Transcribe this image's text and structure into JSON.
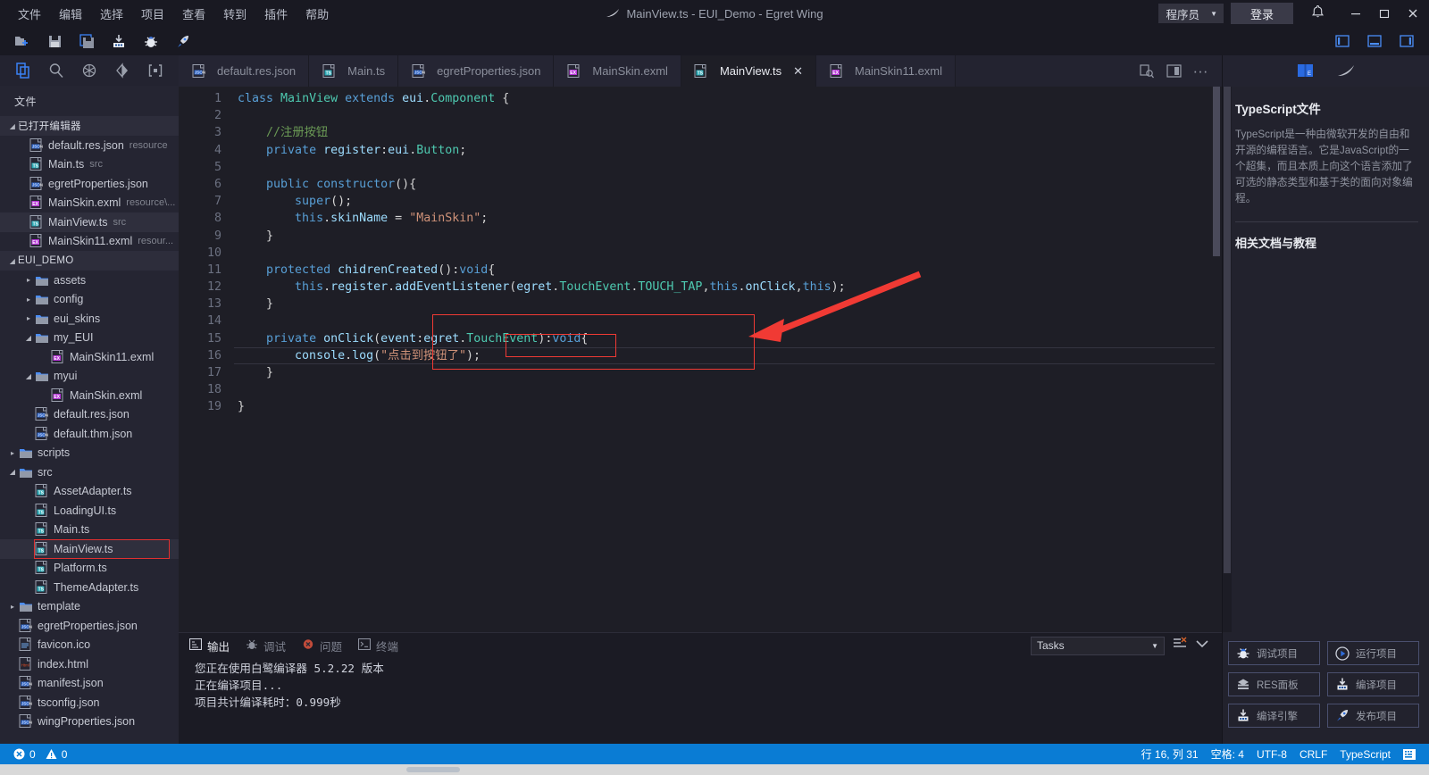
{
  "titlebar": {
    "menus": [
      "文件",
      "编辑",
      "选择",
      "项目",
      "查看",
      "转到",
      "插件",
      "帮助"
    ],
    "title": "MainView.ts - EUI_Demo - Egret Wing",
    "user_role": "程序员",
    "login_label": "登录",
    "icons": [
      "bell-icon",
      "minimize-icon",
      "maximize-icon",
      "close-icon"
    ]
  },
  "toolbar": {
    "icons": [
      "new-file-icon",
      "save-icon",
      "save-all-icon",
      "compile-icon",
      "debug-icon",
      "publish-icon"
    ],
    "layout_icons": [
      "toggle-sidebar-icon",
      "toggle-panel-icon",
      "toggle-right-sidebar-icon"
    ]
  },
  "activitybar": {
    "icons": [
      "explorer-icon",
      "search-icon",
      "extensions-icon",
      "source-control-icon",
      "debug-console-icon"
    ]
  },
  "explorer": {
    "header": "文件",
    "open_editors_label": "已打开编辑器",
    "open_editors": [
      {
        "name": "default.res.json",
        "sub": "resource",
        "icon": "json-file-icon"
      },
      {
        "name": "Main.ts",
        "sub": "src",
        "icon": "ts-file-icon"
      },
      {
        "name": "egretProperties.json",
        "sub": "",
        "icon": "json-file-icon"
      },
      {
        "name": "MainSkin.exml",
        "sub": "resource\\...",
        "icon": "exml-file-icon"
      },
      {
        "name": "MainView.ts",
        "sub": "src",
        "icon": "ts-file-icon",
        "selected": true
      },
      {
        "name": "MainSkin11.exml",
        "sub": "resour...",
        "icon": "exml-file-icon"
      }
    ],
    "project_label": "EUI_DEMO",
    "project_tree": [
      {
        "name": "assets",
        "type": "folder",
        "depth": 1,
        "expanded": false
      },
      {
        "name": "config",
        "type": "folder",
        "depth": 1,
        "expanded": false
      },
      {
        "name": "eui_skins",
        "type": "folder",
        "depth": 1,
        "expanded": false
      },
      {
        "name": "my_EUI",
        "type": "folder",
        "depth": 1,
        "expanded": true
      },
      {
        "name": "MainSkin11.exml",
        "type": "exml",
        "depth": 2
      },
      {
        "name": "myui",
        "type": "folder",
        "depth": 1,
        "expanded": true
      },
      {
        "name": "MainSkin.exml",
        "type": "exml",
        "depth": 2
      },
      {
        "name": "default.res.json",
        "type": "json",
        "depth": 1
      },
      {
        "name": "default.thm.json",
        "type": "json",
        "depth": 1
      },
      {
        "name": "scripts",
        "type": "folder",
        "depth": 0,
        "expanded": false
      },
      {
        "name": "src",
        "type": "folder",
        "depth": 0,
        "expanded": true
      },
      {
        "name": "AssetAdapter.ts",
        "type": "ts",
        "depth": 1
      },
      {
        "name": "LoadingUI.ts",
        "type": "ts",
        "depth": 1
      },
      {
        "name": "Main.ts",
        "type": "ts",
        "depth": 1
      },
      {
        "name": "MainView.ts",
        "type": "ts",
        "depth": 1,
        "highlighted": true,
        "selected": true
      },
      {
        "name": "Platform.ts",
        "type": "ts",
        "depth": 1
      },
      {
        "name": "ThemeAdapter.ts",
        "type": "ts",
        "depth": 1
      },
      {
        "name": "template",
        "type": "folder",
        "depth": 0,
        "expanded": false
      },
      {
        "name": "egretProperties.json",
        "type": "json",
        "depth": 0
      },
      {
        "name": "favicon.ico",
        "type": "ico",
        "depth": 0
      },
      {
        "name": "index.html",
        "type": "html",
        "depth": 0
      },
      {
        "name": "manifest.json",
        "type": "json",
        "depth": 0
      },
      {
        "name": "tsconfig.json",
        "type": "json",
        "depth": 0
      },
      {
        "name": "wingProperties.json",
        "type": "json",
        "depth": 0
      }
    ]
  },
  "editor": {
    "tabs": [
      {
        "label": "default.res.json",
        "icon": "json-file-icon",
        "active": false
      },
      {
        "label": "Main.ts",
        "icon": "ts-file-icon",
        "active": false
      },
      {
        "label": "egretProperties.json",
        "icon": "json-file-icon",
        "active": false
      },
      {
        "label": "MainSkin.exml",
        "icon": "exml-file-icon",
        "active": false
      },
      {
        "label": "MainView.ts",
        "icon": "ts-file-icon",
        "active": true
      },
      {
        "label": "MainSkin11.exml",
        "icon": "exml-file-icon",
        "active": false
      }
    ],
    "tab_actions": [
      "open-changes-icon",
      "split-editor-icon",
      "more-actions-icon"
    ],
    "lines": [
      {
        "n": "1",
        "text": "class MainView extends eui.Component {"
      },
      {
        "n": "2",
        "text": ""
      },
      {
        "n": "3",
        "text": "    //注册按钮"
      },
      {
        "n": "4",
        "text": "    private register:eui.Button;"
      },
      {
        "n": "5",
        "text": ""
      },
      {
        "n": "6",
        "text": "    public constructor(){"
      },
      {
        "n": "7",
        "text": "        super();"
      },
      {
        "n": "8",
        "text": "        this.skinName = \"MainSkin\";"
      },
      {
        "n": "9",
        "text": "    }"
      },
      {
        "n": "10",
        "text": ""
      },
      {
        "n": "11",
        "text": "    protected chidrenCreated():void{"
      },
      {
        "n": "12",
        "text": "        this.register.addEventListener(egret.TouchEvent.TOUCH_TAP,this.onClick,this);"
      },
      {
        "n": "13",
        "text": "    }"
      },
      {
        "n": "14",
        "text": ""
      },
      {
        "n": "15",
        "text": "    private onClick(event:egret.TouchEvent):void{"
      },
      {
        "n": "16",
        "text": "        console.log(\"点击到按钮了\");"
      },
      {
        "n": "17",
        "text": "    }"
      },
      {
        "n": "18",
        "text": ""
      },
      {
        "n": "19",
        "text": "}"
      }
    ],
    "annotation_color": "#f03a34"
  },
  "panel": {
    "tabs": [
      {
        "label": "输出",
        "icon": "output-icon",
        "active": true
      },
      {
        "label": "调试",
        "icon": "debug-icon",
        "active": false
      },
      {
        "label": "问题",
        "icon": "problems-icon",
        "active": false
      },
      {
        "label": "终端",
        "icon": "terminal-icon",
        "active": false
      }
    ],
    "select_value": "Tasks",
    "actions": [
      "clear-output-icon",
      "collapse-panel-icon"
    ],
    "output_lines": [
      "您正在使用白鹭编译器 5.2.22 版本",
      "正在编译项目...",
      "项目共计编译耗时：0.999秒"
    ]
  },
  "rightpanel": {
    "tabs": [
      "doc-icon",
      "egret-wing-icon"
    ],
    "title": "TypeScript文件",
    "description": "TypeScript是一种由微软开发的自由和开源的编程语言。它是JavaScript的一个超集，而且本质上向这个语言添加了可选的静态类型和基于类的面向对象编程。",
    "sub_title": "相关文档与教程",
    "actions": [
      {
        "label": "调试项目",
        "icon": "bug-icon"
      },
      {
        "label": "运行项目",
        "icon": "play-icon"
      },
      {
        "label": "RES面板",
        "icon": "res-icon"
      },
      {
        "label": "编译项目",
        "icon": "compile-icon"
      },
      {
        "label": "编译引擎",
        "icon": "compile-engine-icon"
      },
      {
        "label": "发布项目",
        "icon": "rocket-icon"
      }
    ]
  },
  "statusbar": {
    "errors": "0",
    "warnings": "0",
    "position": "行 16, 列 31",
    "spaces": "空格: 4",
    "encoding": "UTF-8",
    "eol": "CRLF",
    "language": "TypeScript",
    "feedback_icon": "keyboard-icon",
    "accent": "#0a7cd4"
  }
}
